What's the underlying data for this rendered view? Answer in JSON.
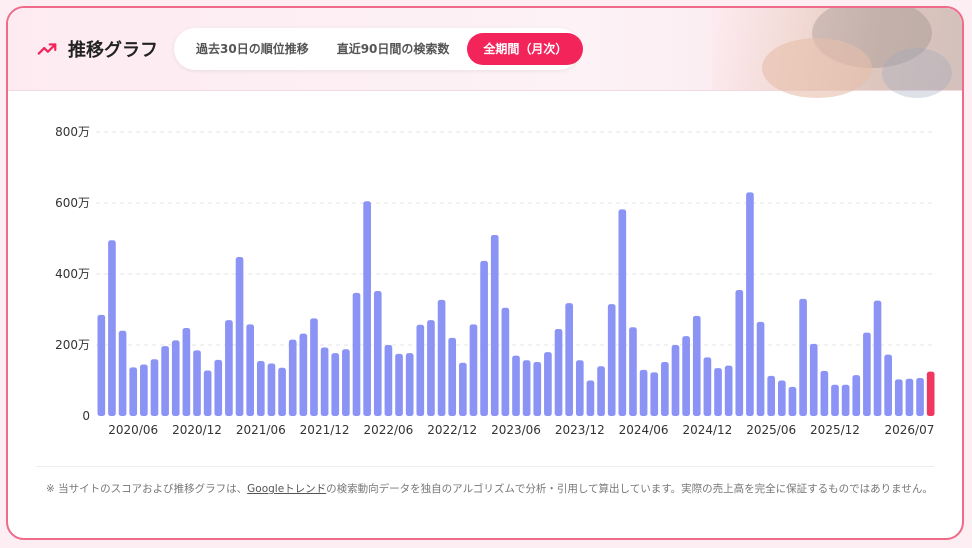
{
  "header": {
    "title": "推移グラフ",
    "tabs": [
      {
        "label": "過去30日の順位推移",
        "active": false
      },
      {
        "label": "直近90日間の検索数",
        "active": false
      },
      {
        "label": "全期間（月次）",
        "active": true
      }
    ]
  },
  "footer": {
    "note_prefix": "※ 当サイトのスコアおよび推移グラフは、",
    "note_link": "Googleトレンド",
    "note_suffix": "の検索動向データを独自のアルゴリズムで分析・引用して算出しています。実際の売上高を完全に保証するものではありません。"
  },
  "colors": {
    "bar": "#8b93f5",
    "bar_highlight": "#f2375f",
    "accent": "#f2245a",
    "border": "#f06a8a"
  },
  "chart_data": {
    "type": "bar",
    "title": "",
    "xlabel": "",
    "ylabel": "",
    "ylim": [
      0,
      800
    ],
    "yticks": [
      0,
      200,
      400,
      600,
      800
    ],
    "ytick_labels": [
      "0",
      "200万",
      "400万",
      "600万",
      "800万"
    ],
    "xtick_labels": [
      "2020/06",
      "2020/12",
      "2021/06",
      "2021/12",
      "2022/06",
      "2022/12",
      "2023/06",
      "2023/12",
      "2024/06",
      "2024/12",
      "2025/06",
      "2025/12",
      "2026/07"
    ],
    "xtick_indices": [
      3,
      9,
      15,
      21,
      27,
      33,
      39,
      45,
      51,
      57,
      63,
      69,
      76
    ],
    "categories": [
      "2020/03",
      "2020/04",
      "2020/05",
      "2020/06",
      "2020/07",
      "2020/08",
      "2020/09",
      "2020/10",
      "2020/11",
      "2020/12",
      "2021/01",
      "2021/02",
      "2021/03",
      "2021/04",
      "2021/05",
      "2021/06",
      "2021/07",
      "2021/08",
      "2021/09",
      "2021/10",
      "2021/11",
      "2021/12",
      "2022/01",
      "2022/02",
      "2022/03",
      "2022/04",
      "2022/05",
      "2022/06",
      "2022/07",
      "2022/08",
      "2022/09",
      "2022/10",
      "2022/11",
      "2022/12",
      "2023/01",
      "2023/02",
      "2023/03",
      "2023/04",
      "2023/05",
      "2023/06",
      "2023/07",
      "2023/08",
      "2023/09",
      "2023/10",
      "2023/11",
      "2023/12",
      "2024/01",
      "2024/02",
      "2024/03",
      "2024/04",
      "2024/05",
      "2024/06",
      "2024/07",
      "2024/08",
      "2024/09",
      "2024/10",
      "2024/11",
      "2024/12",
      "2025/01",
      "2025/02",
      "2025/03",
      "2025/04",
      "2025/05",
      "2025/06",
      "2025/07",
      "2025/08",
      "2025/09",
      "2025/10",
      "2025/11",
      "2025/12",
      "2026/01",
      "2026/02",
      "2026/03",
      "2026/04",
      "2026/05",
      "2026/06",
      "2026/07",
      "2026/08"
    ],
    "values": [
      285,
      495,
      240,
      137,
      145,
      160,
      197,
      213,
      248,
      185,
      128,
      158,
      270,
      448,
      258,
      155,
      148,
      136,
      215,
      232,
      275,
      193,
      177,
      188,
      347,
      605,
      352,
      200,
      175,
      177,
      257,
      270,
      327,
      220,
      150,
      258,
      437,
      510,
      305,
      170,
      157,
      152,
      180,
      245,
      318,
      157,
      100,
      140,
      315,
      582,
      250,
      130,
      123,
      152,
      200,
      225,
      282,
      165,
      135,
      142,
      355,
      630,
      265,
      113,
      100,
      82,
      330,
      203,
      127,
      88,
      88,
      115,
      235,
      325,
      173,
      103,
      105,
      107,
      125
    ],
    "highlight_last": true,
    "grid": true
  }
}
